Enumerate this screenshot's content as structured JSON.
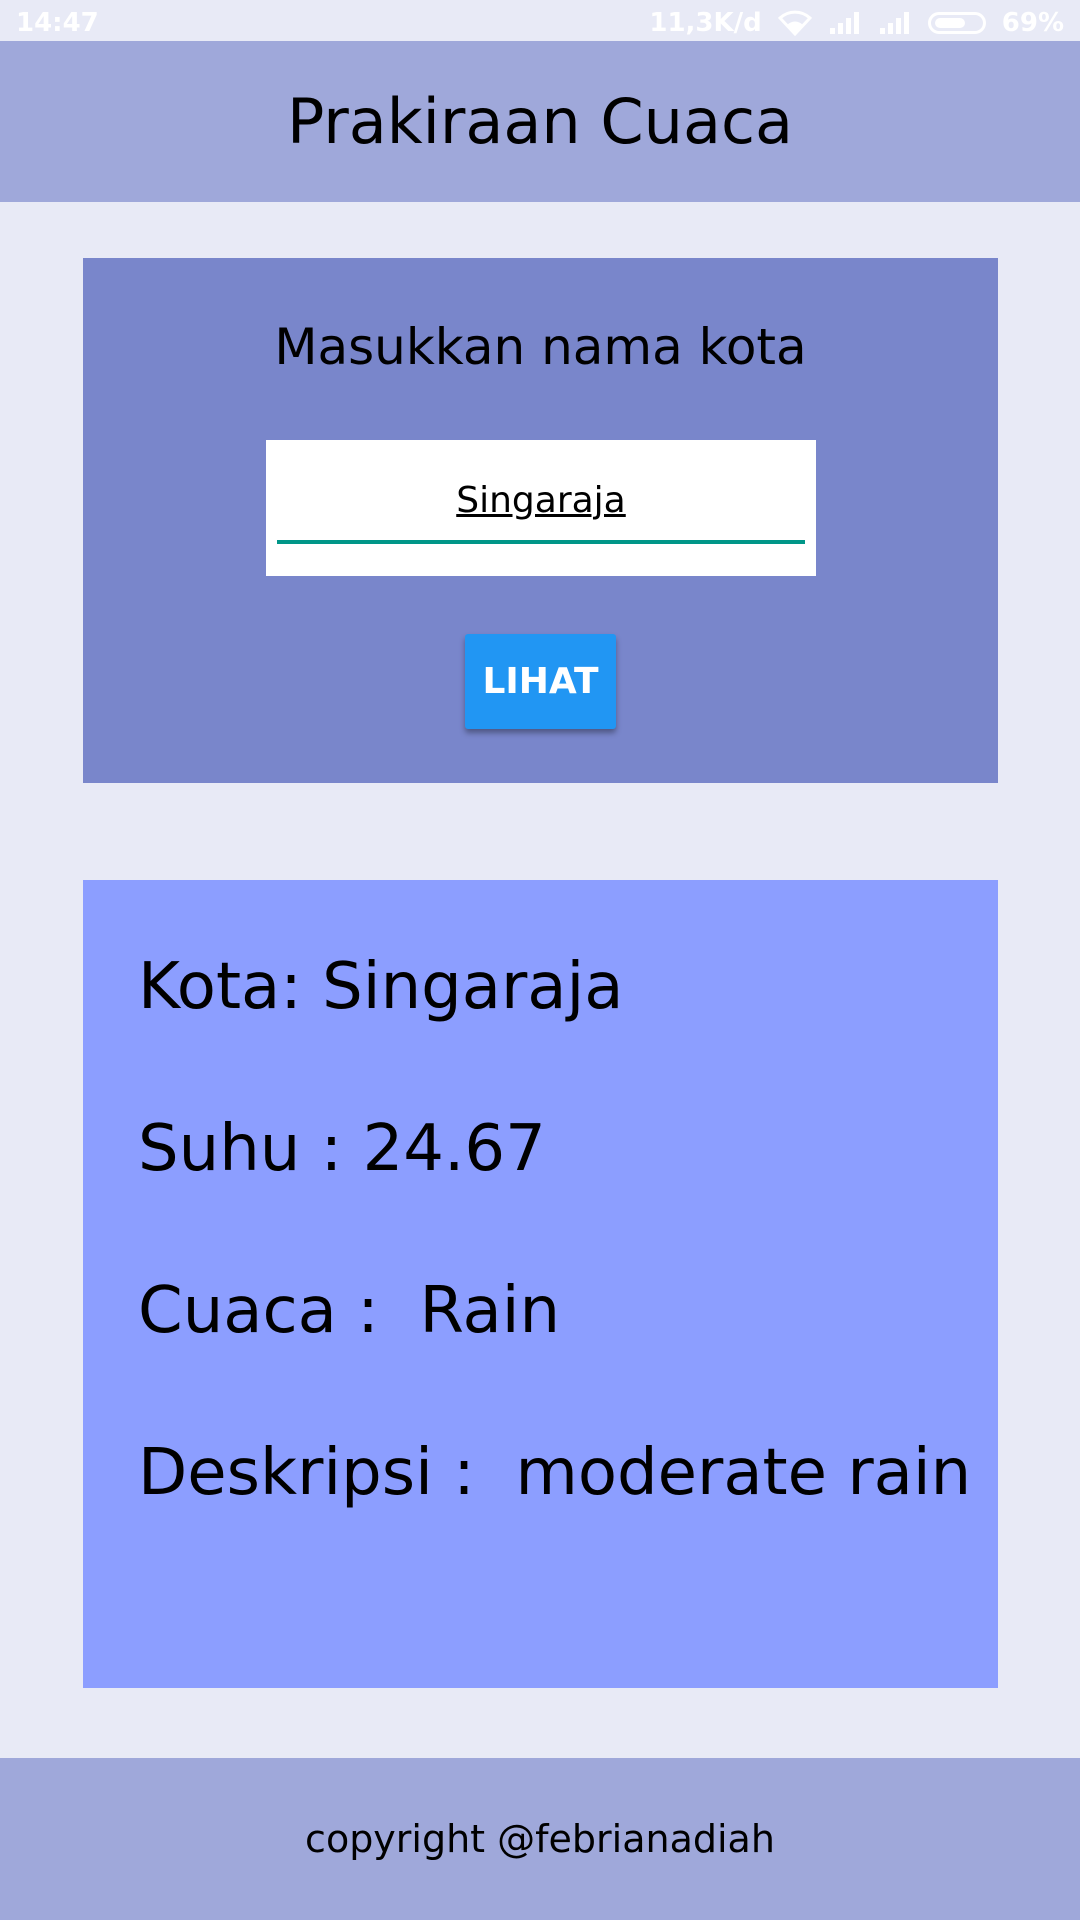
{
  "status_bar": {
    "time": "14:47",
    "network_speed": "11,3K/d",
    "battery": "69%",
    "battery_level": 0.69,
    "icons": [
      "wifi-icon",
      "signal-icon",
      "signal-icon",
      "battery-icon"
    ]
  },
  "header": {
    "title": "Prakiraan Cuaca"
  },
  "search": {
    "label": "Masukkan nama kota",
    "value": "Singaraja",
    "button_label": "LIHAT"
  },
  "result": {
    "kota": "Kota: Singaraja",
    "suhu": "Suhu : 24.67",
    "cuaca": "Cuaca :  Rain",
    "deskripsi": "Deskripsi :  moderate rain"
  },
  "footer": {
    "text": "copyright @febrianadiah"
  },
  "colors": {
    "background": "#e8eaf6",
    "app_bar": "#9fa8da",
    "input_card": "#7986cb",
    "result_card": "#8c9eff",
    "button": "#2196f3",
    "input_underline": "#009688"
  }
}
